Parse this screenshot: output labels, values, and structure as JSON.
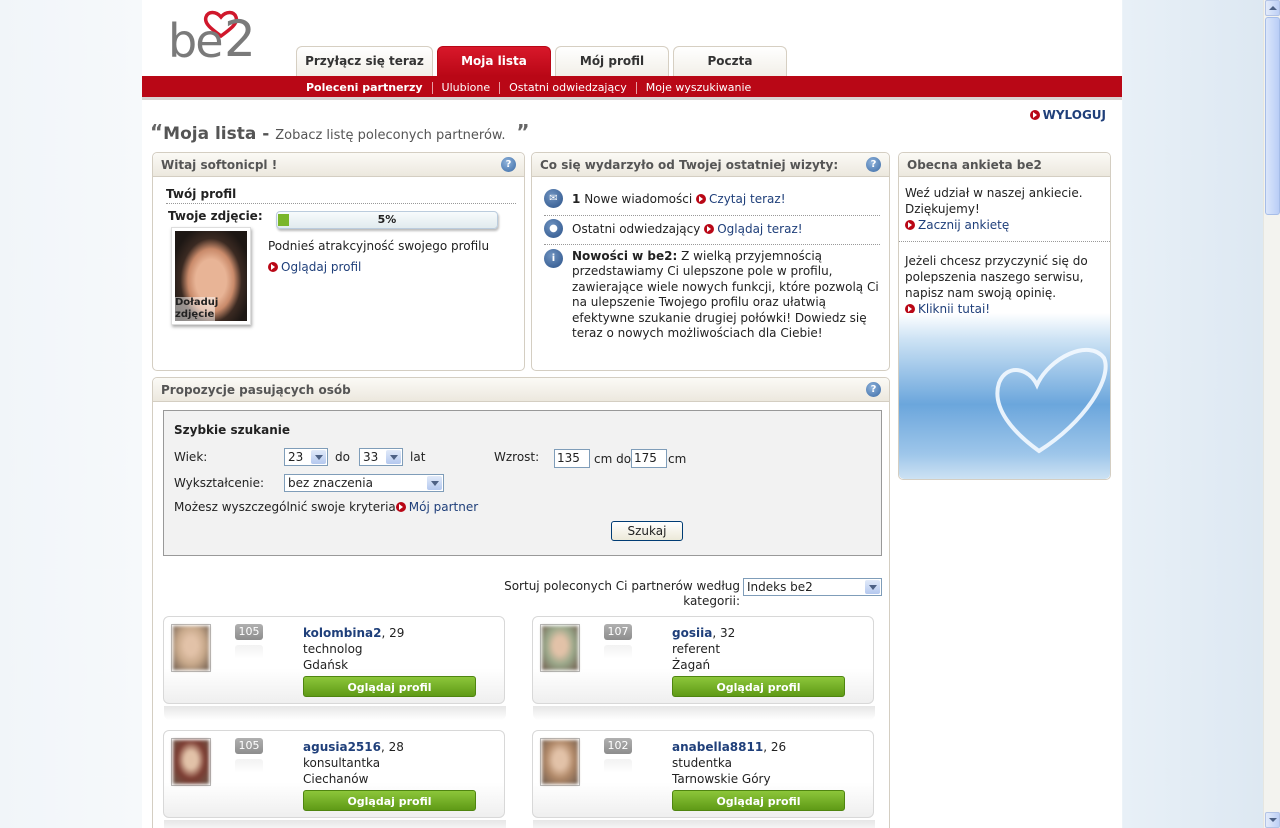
{
  "logo": {
    "text_a": "be",
    "text_b": "2"
  },
  "tabs": [
    {
      "label": "Przyłącz się teraz"
    },
    {
      "label": "Moja lista"
    },
    {
      "label": "Mój profil"
    },
    {
      "label": "Poczta"
    }
  ],
  "subnav": [
    {
      "label": "Poleceni partnerzy"
    },
    {
      "label": "Ulubione"
    },
    {
      "label": "Ostatni odwiedzający"
    },
    {
      "label": "Moje wyszukiwanie"
    }
  ],
  "logout": "WYLOGUJ",
  "heading": {
    "quote_open": "“",
    "title": "Moja lista",
    "dash": " - ",
    "subtitle": "Zobacz listę poleconych partnerów.",
    "quote_close": "”"
  },
  "welcome": {
    "header": "Witaj softonicpl !",
    "profile_title": "Twój profil",
    "photo_label": "Twoje zdjęcie:",
    "photo_overlay": "Doładuj zdjęcie",
    "progress_text": "5%",
    "progress_value": 0.05,
    "improve_text": "Podnieś atrakcyjność swojego profilu",
    "view_profile": "Oglądaj profil"
  },
  "news": {
    "header": "Co się wydarzyło od Twojej ostatniej wizyty:",
    "messages_count": "1",
    "messages_text": "Nowe wiadomości",
    "messages_link": "Czytaj teraz!",
    "visitors_text": "Ostatni odwiedzający",
    "visitors_link": "Oglądaj teraz!",
    "news_title": "Nowości w be2:",
    "news_body": "Z wielką przyjemnością przedstawiamy Ci ulepszone pole w profilu, zawierające wiele nowych funkcji, które pozwolą Ci na ulepszenie Twojego profilu oraz ułatwią efektywne szukanie drugiej połówki! Dowiedz się teraz o nowych możliwościach dla Ciebie!"
  },
  "poll": {
    "header": "Obecna ankieta be2",
    "p1": "Weź udział w naszej ankiecie. Dziękujemy!",
    "p1_link": "Zacznij ankietę",
    "p2": "Jeżeli chcesz przyczynić się do polepszenia naszego serwisu, napisz nam swoją opinię.",
    "p2_link": "Kliknij tutaj!"
  },
  "matches": {
    "header": "Propozycje pasujących osób",
    "quick_search": {
      "title": "Szybkie szukanie",
      "age_label": "Wiek:",
      "age_from": "23",
      "to_label": "do",
      "age_to": "33",
      "years_label": "lat",
      "height_label": "Wzrost:",
      "height_from": "135",
      "cm_do": "cm do",
      "height_to": "175",
      "cm": "cm",
      "education_label": "Wykształcenie:",
      "education_value": "bez znaczenia",
      "criteria_text": "Możesz wyszczególnić swoje kryteria",
      "criteria_link": "Mój partner",
      "search_button": "Szukaj"
    },
    "sort_label": "Sortuj poleconych Ci partnerów według kategorii:",
    "sort_value": "Indeks be2",
    "cards": [
      {
        "name": "kolombina2",
        "age": ", 29",
        "job": "technolog",
        "city": "Gdańsk",
        "score": "105",
        "button": "Oglądaj profil",
        "photo": "#c7a88a"
      },
      {
        "name": "gosiia",
        "age": ", 32",
        "job": "referent",
        "city": "Żagań",
        "score": "107",
        "button": "Oglądaj profil",
        "photo": "#9aa88a"
      },
      {
        "name": "agusia2516",
        "age": ", 28",
        "job": "konsultantka",
        "city": "Ciechanów",
        "score": "105",
        "button": "Oglądaj profil",
        "photo": "#7a3a30"
      },
      {
        "name": "anabella8811",
        "age": ", 26",
        "job": "studentka",
        "city": "Tarnowskie Góry",
        "score": "102",
        "button": "Oglądaj profil",
        "photo": "#b08868"
      }
    ]
  }
}
